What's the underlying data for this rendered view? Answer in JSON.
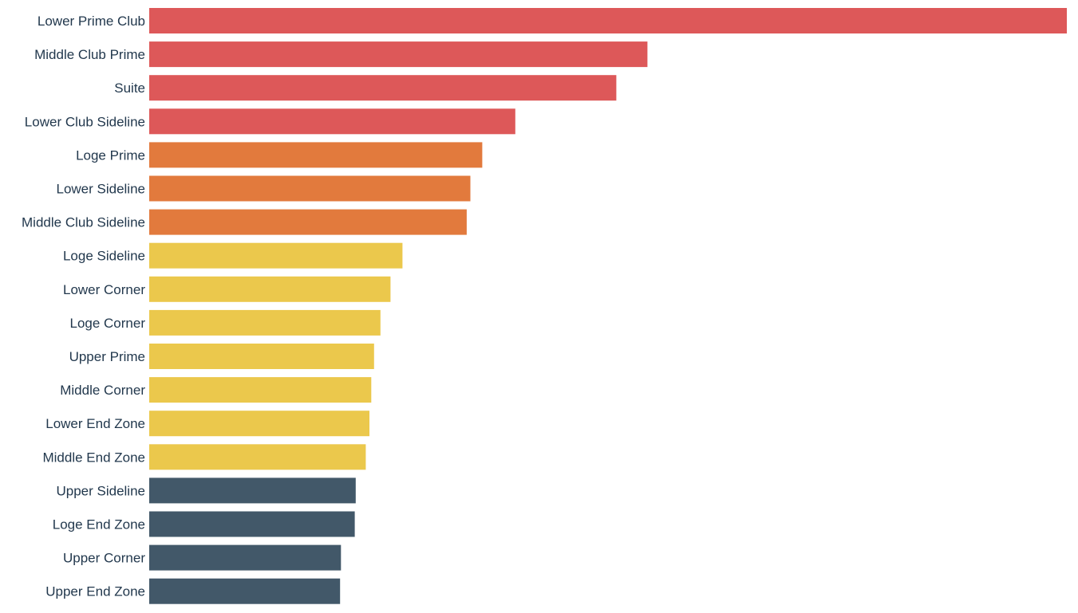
{
  "chart_data": {
    "type": "bar",
    "orientation": "horizontal",
    "title": "",
    "xlabel": "",
    "ylabel": "",
    "value_units": "relative (max = 100)",
    "xlim": [
      0,
      100
    ],
    "grid": false,
    "legend": "none",
    "categories": [
      "Lower Prime Club",
      "Middle Club Prime",
      "Suite",
      "Lower Club Sideline",
      "Loge Prime",
      "Lower Sideline",
      "Middle Club Sideline",
      "Loge Sideline",
      "Lower Corner",
      "Loge Corner",
      "Upper Prime",
      "Middle Corner",
      "Lower End Zone",
      "Middle End Zone",
      "Upper Sideline",
      "Loge End Zone",
      "Upper Corner",
      "Upper End Zone"
    ],
    "values": [
      100,
      54.3,
      50.9,
      39.9,
      36.3,
      35.0,
      34.6,
      27.6,
      26.3,
      25.2,
      24.5,
      24.2,
      24.0,
      23.6,
      22.5,
      22.4,
      20.9,
      20.8
    ],
    "tiers": [
      0,
      0,
      0,
      0,
      1,
      1,
      1,
      2,
      2,
      2,
      2,
      2,
      2,
      2,
      3,
      3,
      3,
      3
    ],
    "tier_colors": [
      "#dd5859",
      "#e27a3d",
      "#ebc84c",
      "#425869"
    ]
  },
  "colors": {
    "label_text": "#22384d",
    "background": "#ffffff"
  }
}
